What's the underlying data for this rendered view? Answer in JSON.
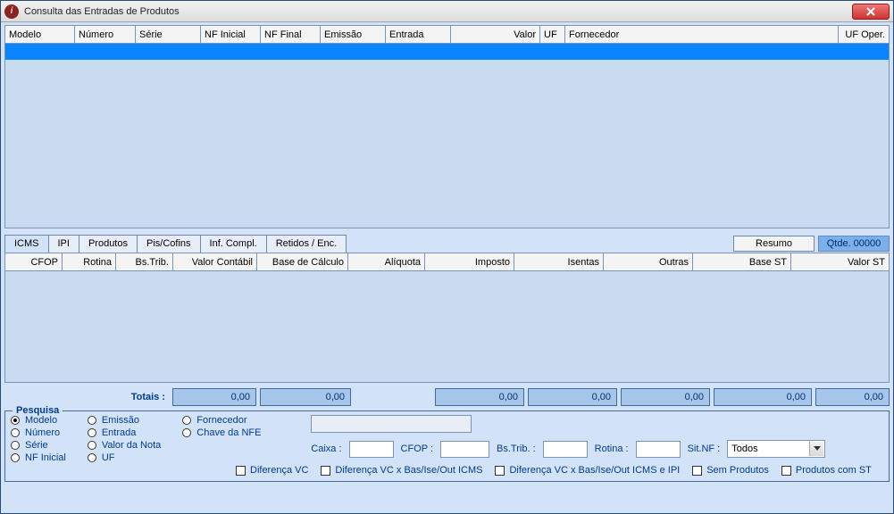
{
  "window": {
    "title": "Consulta das Entradas de Produtos"
  },
  "topGrid": {
    "cols": [
      "Modelo",
      "Número",
      "Série",
      "NF Inicial",
      "NF Final",
      "Emissão",
      "Entrada",
      "Valor",
      "UF",
      "Fornecedor",
      "UF Oper."
    ]
  },
  "tabs": {
    "items": [
      "ICMS",
      "IPI",
      "Produtos",
      "Pis/Cofins",
      "Inf. Compl.",
      "Retidos / Enc."
    ],
    "resumo": "Resumo",
    "qtde": "Qtde. 00000"
  },
  "bottomGrid": {
    "cols": [
      "CFOP",
      "Rotina",
      "Bs.Trib.",
      "Valor Contábil",
      "Base de Cálculo",
      "Alíquota",
      "Imposto",
      "Isentas",
      "Outras",
      "Base ST",
      "Valor ST"
    ]
  },
  "totals": {
    "label": "Totais :",
    "vcont": "0,00",
    "bcalc": "0,00",
    "imp": "0,00",
    "isent": "0,00",
    "out": "0,00",
    "bst": "0,00",
    "vst": "0,00"
  },
  "pesquisa": {
    "legend": "Pesquisa",
    "radios": {
      "col1": [
        "Modelo",
        "Número",
        "Série",
        "NF Inicial"
      ],
      "col2": [
        "Emissão",
        "Entrada",
        "Valor da Nota",
        "UF"
      ],
      "col3": [
        "Fornecedor",
        "Chave da NFE"
      ]
    },
    "labels": {
      "caixa": "Caixa :",
      "cfop": "CFOP :",
      "bstrib": "Bs.Trib. :",
      "rotina": "Rotina :",
      "sitnf": "Sit.NF :"
    },
    "sitnf_value": "Todos",
    "checks": [
      "Diferença VC",
      "Diferença VC x Bas/Ise/Out ICMS",
      "Diferença VC x Bas/Ise/Out ICMS e IPI",
      "Sem Produtos",
      "Produtos com ST"
    ]
  }
}
